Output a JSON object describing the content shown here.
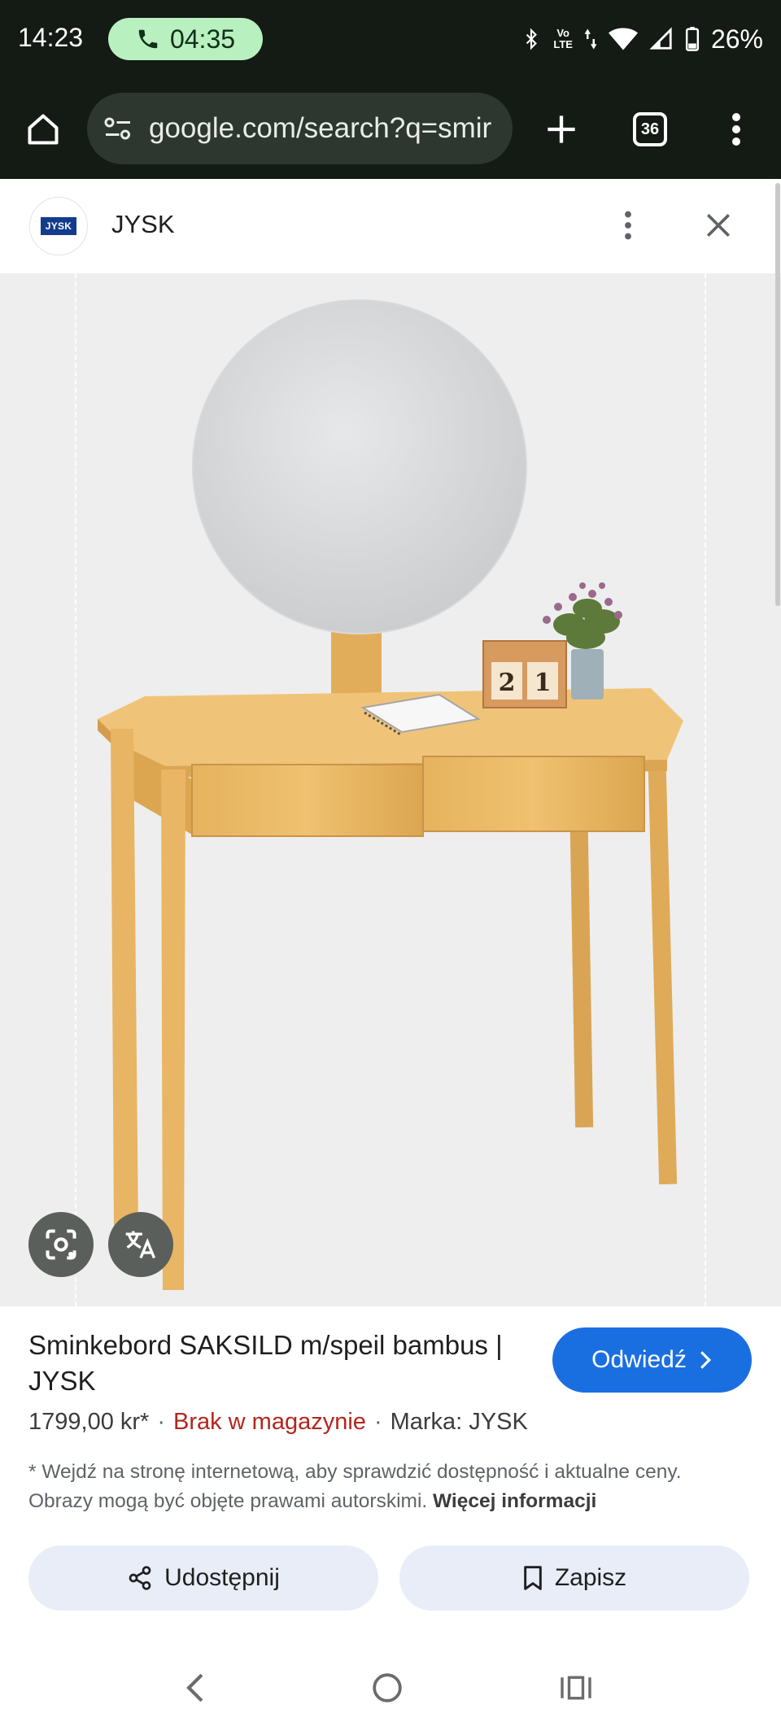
{
  "status_bar": {
    "time": "14:23",
    "call_timer": "04:35",
    "network_label_top": "Vo",
    "network_label_bottom": "LTE",
    "battery": "26%"
  },
  "browser": {
    "url": "google.com/search?q=smir",
    "tab_count": "36"
  },
  "source": {
    "logo_text": "JYSK",
    "name": "JYSK"
  },
  "image": {
    "calendar_digit_1": "2",
    "calendar_digit_2": "1"
  },
  "product": {
    "title": "Sminkebord SAKSILD m/speil bambus | JYSK",
    "visit_label": "Odwiedź",
    "price": "1799,00 kr*",
    "stock_status": "Brak w magazynie",
    "brand": "Marka: JYSK",
    "separator": "·",
    "disclaimer": "* Wejdź na stronę internetową, aby sprawdzić dostępność i aktualne ceny. Obrazy mogą być objęte prawami autorskimi.",
    "more_info": "Więcej informacji"
  },
  "actions": {
    "share_label": "Udostępnij",
    "save_label": "Zapisz"
  },
  "colors": {
    "system_bar": "#141a14",
    "call_pill": "#b9f0c0",
    "visit_button": "#1a6fe0",
    "out_of_stock": "#b3261e",
    "action_button_bg": "#e8edf8"
  }
}
